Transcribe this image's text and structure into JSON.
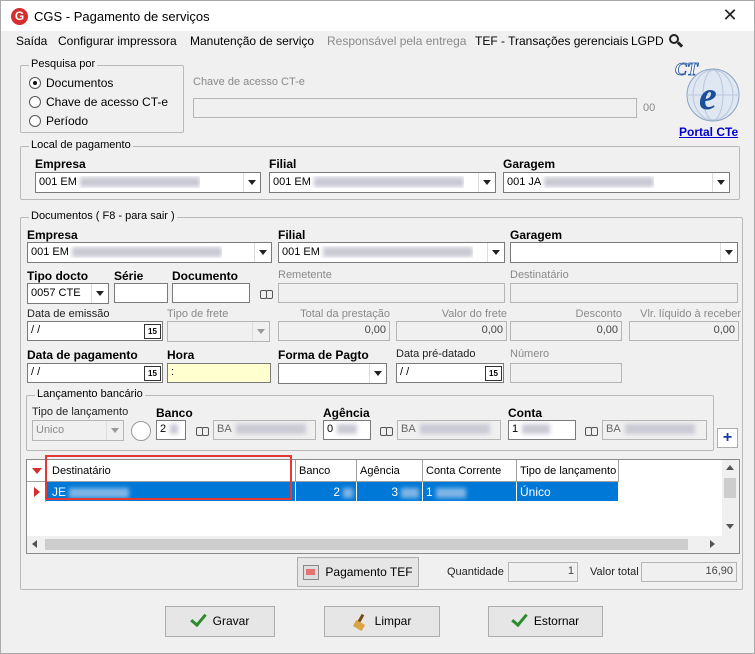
{
  "window": {
    "title": "CGS - Pagamento de serviços",
    "close_glyph": "✕",
    "app_icon_letter": "G"
  },
  "menu": {
    "items": [
      "Saída",
      "Configurar impressora",
      "Manutenção de serviço",
      "Responsável pela entrega",
      "TEF - Transações gerenciais",
      "LGPD"
    ],
    "disabled_index": 3
  },
  "pesquisa": {
    "legend": "Pesquisa por",
    "options": [
      "Documentos",
      "Chave de acesso CT-e",
      "Período"
    ],
    "selected": "Documentos",
    "chave_label": "Chave de acesso CT-e",
    "chave_value": "",
    "chave_suffix": "00"
  },
  "cte": {
    "logo_text": "CT",
    "logo_e": "e",
    "portal_link": "Portal CTe"
  },
  "local_pagamento": {
    "legend": "Local de pagamento",
    "empresa_label": "Empresa",
    "empresa_value": "001 EM",
    "filial_label": "Filial",
    "filial_value": "001 EM",
    "garagem_label": "Garagem",
    "garagem_value": "001 JA"
  },
  "documentos": {
    "legend": "Documentos ( F8 - para sair )",
    "empresa_label": "Empresa",
    "empresa_value": "001 EM",
    "filial_label": "Filial",
    "filial_value": "001 EM",
    "garagem_label": "Garagem",
    "garagem_value": "",
    "tipo_docto_label": "Tipo docto",
    "tipo_docto_value": "0057 CTE",
    "serie_label": "Série",
    "serie_value": "",
    "documento_label": "Documento",
    "documento_value": "",
    "remetente_label": "Remetente",
    "remetente_value": "",
    "destinatario_label": "Destinatário",
    "destinatario_value": "",
    "data_emissao_label": "Data de emissão",
    "data_emissao_value": " /  /",
    "tipo_frete_label": "Tipo de frete",
    "tipo_frete_value": "",
    "total_prestacao_label": "Total da prestação",
    "total_prestacao_value": "0,00",
    "valor_frete_label": "Valor do frete",
    "valor_frete_value": "0,00",
    "desconto_label": "Desconto",
    "desconto_value": "0,00",
    "liquido_label": "Vlr. líquido à receber",
    "liquido_value": "0,00",
    "data_pagamento_label": "Data de pagamento",
    "data_pagamento_value": " /  /",
    "hora_label": "Hora",
    "hora_value": ":",
    "forma_pagto_label": "Forma de Pagto",
    "forma_pagto_value": "",
    "data_predatado_label": "Data pré-datado",
    "data_predatado_value": " /  /",
    "numero_label": "Número",
    "numero_value": "",
    "calendar_glyph": "15"
  },
  "lancamento": {
    "legend": "Lançamento bancário",
    "tipo_label": "Tipo de lançamento",
    "tipo_value": "Único",
    "banco_label": "Banco",
    "banco_value": "2",
    "banco_nome": "BA",
    "agencia_label": "Agência",
    "agencia_value": "0",
    "agencia_nome": "BA",
    "conta_label": "Conta",
    "conta_value": "1",
    "conta_nome": "BA",
    "add_glyph": "+"
  },
  "grid": {
    "columns": [
      "Destinatário",
      "Banco",
      "Agência",
      "Conta Corrente",
      "Tipo de lançamento"
    ],
    "rows": [
      {
        "destinatario": "JE",
        "banco": "2",
        "agencia": "3",
        "conta_corrente": "1",
        "tipo_lancamento": "Único"
      }
    ]
  },
  "footer": {
    "pagamento_tef_label": "Pagamento TEF",
    "quantidade_label": "Quantidade",
    "quantidade_value": "1",
    "valor_total_label": "Valor total",
    "valor_total_value": "16,90"
  },
  "actions": {
    "gravar_label": "Gravar",
    "limpar_label": "Limpar",
    "estornar_label": "Estornar"
  },
  "colors": {
    "selection_blue": "#0078d7",
    "highlight_red": "#e53935",
    "link_blue": "#0000cc",
    "hora_yellow": "#ffffd0"
  }
}
